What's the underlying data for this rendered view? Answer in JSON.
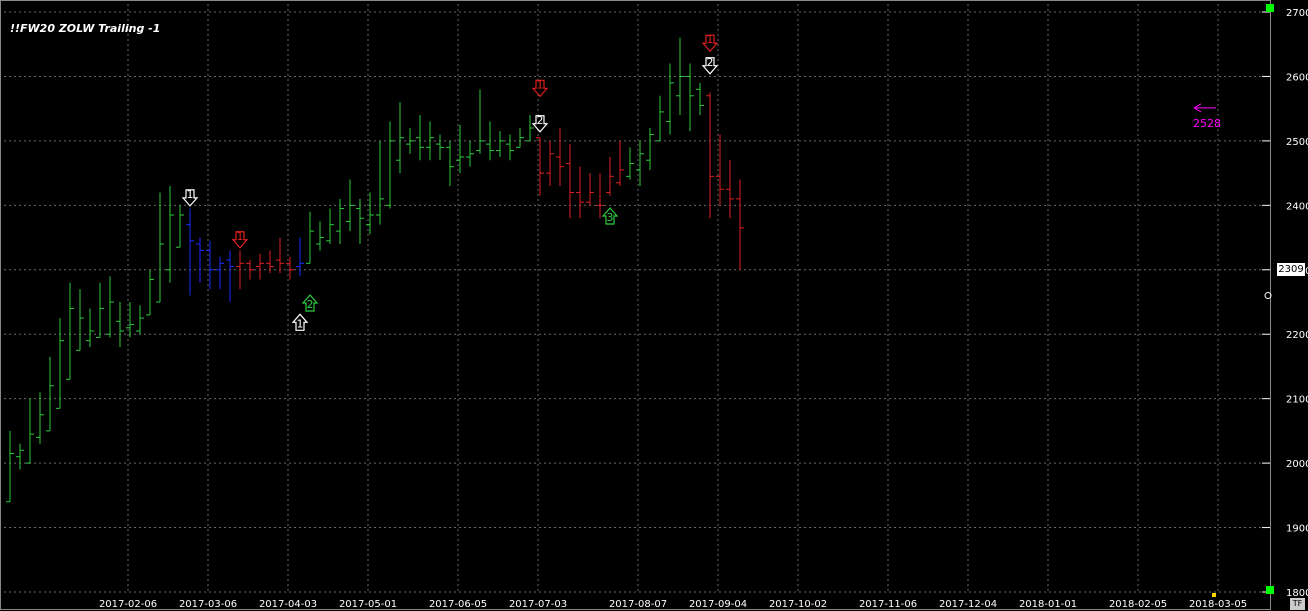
{
  "title": "!!FW20 ZOLW Trailing -1",
  "last_price_label": "2309",
  "stop_label": "2528",
  "corner_label": "TF",
  "colors": {
    "background": "#000000",
    "up": "#2ecc40",
    "down": "#e02020",
    "neutral": "#1a2cff",
    "grid": "#6a6a6a",
    "marker_white": "#ffffff",
    "marker_red": "#e02020",
    "marker_green": "#2ecc40",
    "stop": "#ff00ff"
  },
  "chart_data": {
    "type": "bar",
    "subtype": "ohlc",
    "y_ticks": [
      "1800",
      "1900",
      "2000",
      "2100",
      "2200",
      "2300",
      "2400",
      "2500",
      "2600",
      "2700"
    ],
    "ylim": [
      1800,
      2700
    ],
    "x_ticks": [
      "2017-02-06",
      "2017-03-06",
      "2017-04-03",
      "2017-05-01",
      "2017-06-05",
      "2017-07-03",
      "2017-08-07",
      "2017-09-04",
      "2017-10-02",
      "2017-11-06",
      "2017-12-04",
      "2018-01-01",
      "2018-02-05",
      "2018-03-05"
    ],
    "x_tick_index": [
      12,
      20,
      28,
      36,
      45,
      53,
      63,
      71,
      79,
      88,
      96,
      104,
      113,
      121
    ],
    "bars": [
      {
        "o": 1940,
        "h": 2050,
        "l": 1940,
        "c": 2015,
        "color": "up"
      },
      {
        "o": 2010,
        "h": 2030,
        "l": 1990,
        "c": 2020,
        "color": "up"
      },
      {
        "o": 2000,
        "h": 2100,
        "l": 2000,
        "c": 2045,
        "color": "up"
      },
      {
        "o": 2040,
        "h": 2110,
        "l": 2030,
        "c": 2075,
        "color": "up"
      },
      {
        "o": 2050,
        "h": 2165,
        "l": 2050,
        "c": 2120,
        "color": "up"
      },
      {
        "o": 2085,
        "h": 2225,
        "l": 2085,
        "c": 2190,
        "color": "up"
      },
      {
        "o": 2130,
        "h": 2280,
        "l": 2130,
        "c": 2240,
        "color": "up"
      },
      {
        "o": 2175,
        "h": 2270,
        "l": 2175,
        "c": 2225,
        "color": "up"
      },
      {
        "o": 2190,
        "h": 2240,
        "l": 2180,
        "c": 2205,
        "color": "up"
      },
      {
        "o": 2195,
        "h": 2280,
        "l": 2195,
        "c": 2240,
        "color": "up"
      },
      {
        "o": 2200,
        "h": 2290,
        "l": 2195,
        "c": 2250,
        "color": "up"
      },
      {
        "o": 2220,
        "h": 2250,
        "l": 2180,
        "c": 2205,
        "color": "up"
      },
      {
        "o": 2210,
        "h": 2250,
        "l": 2195,
        "c": 2215,
        "color": "up"
      },
      {
        "o": 2205,
        "h": 2245,
        "l": 2200,
        "c": 2225,
        "color": "up"
      },
      {
        "o": 2230,
        "h": 2300,
        "l": 2230,
        "c": 2285,
        "color": "up"
      },
      {
        "o": 2250,
        "h": 2420,
        "l": 2250,
        "c": 2340,
        "color": "up"
      },
      {
        "o": 2300,
        "h": 2430,
        "l": 2280,
        "c": 2385,
        "color": "up"
      },
      {
        "o": 2335,
        "h": 2400,
        "l": 2335,
        "c": 2385,
        "color": "up"
      },
      {
        "o": 2370,
        "h": 2395,
        "l": 2260,
        "c": 2345,
        "color": "neutral"
      },
      {
        "o": 2340,
        "h": 2350,
        "l": 2280,
        "c": 2330,
        "color": "neutral"
      },
      {
        "o": 2330,
        "h": 2345,
        "l": 2270,
        "c": 2300,
        "color": "neutral"
      },
      {
        "o": 2300,
        "h": 2320,
        "l": 2270,
        "c": 2310,
        "color": "neutral"
      },
      {
        "o": 2315,
        "h": 2330,
        "l": 2250,
        "c": 2305,
        "color": "neutral"
      },
      {
        "o": 2305,
        "h": 2330,
        "l": 2270,
        "c": 2310,
        "color": "down"
      },
      {
        "o": 2310,
        "h": 2315,
        "l": 2285,
        "c": 2300,
        "color": "down"
      },
      {
        "o": 2305,
        "h": 2325,
        "l": 2285,
        "c": 2310,
        "color": "down"
      },
      {
        "o": 2310,
        "h": 2330,
        "l": 2295,
        "c": 2305,
        "color": "down"
      },
      {
        "o": 2315,
        "h": 2350,
        "l": 2295,
        "c": 2310,
        "color": "down"
      },
      {
        "o": 2310,
        "h": 2320,
        "l": 2285,
        "c": 2300,
        "color": "down"
      },
      {
        "o": 2305,
        "h": 2350,
        "l": 2290,
        "c": 2310,
        "color": "neutral"
      },
      {
        "o": 2310,
        "h": 2390,
        "l": 2310,
        "c": 2360,
        "color": "up"
      },
      {
        "o": 2340,
        "h": 2375,
        "l": 2330,
        "c": 2350,
        "color": "up"
      },
      {
        "o": 2345,
        "h": 2395,
        "l": 2340,
        "c": 2370,
        "color": "up"
      },
      {
        "o": 2360,
        "h": 2410,
        "l": 2340,
        "c": 2395,
        "color": "up"
      },
      {
        "o": 2375,
        "h": 2440,
        "l": 2360,
        "c": 2400,
        "color": "up"
      },
      {
        "o": 2395,
        "h": 2410,
        "l": 2340,
        "c": 2380,
        "color": "up"
      },
      {
        "o": 2370,
        "h": 2420,
        "l": 2355,
        "c": 2385,
        "color": "up"
      },
      {
        "o": 2385,
        "h": 2500,
        "l": 2370,
        "c": 2410,
        "color": "up"
      },
      {
        "o": 2400,
        "h": 2530,
        "l": 2395,
        "c": 2500,
        "color": "up"
      },
      {
        "o": 2470,
        "h": 2560,
        "l": 2450,
        "c": 2505,
        "color": "up"
      },
      {
        "o": 2495,
        "h": 2520,
        "l": 2480,
        "c": 2500,
        "color": "up"
      },
      {
        "o": 2505,
        "h": 2540,
        "l": 2470,
        "c": 2490,
        "color": "up"
      },
      {
        "o": 2490,
        "h": 2530,
        "l": 2470,
        "c": 2505,
        "color": "up"
      },
      {
        "o": 2495,
        "h": 2510,
        "l": 2470,
        "c": 2490,
        "color": "up"
      },
      {
        "o": 2490,
        "h": 2500,
        "l": 2430,
        "c": 2460,
        "color": "up"
      },
      {
        "o": 2470,
        "h": 2525,
        "l": 2450,
        "c": 2475,
        "color": "up"
      },
      {
        "o": 2475,
        "h": 2500,
        "l": 2460,
        "c": 2480,
        "color": "up"
      },
      {
        "o": 2485,
        "h": 2580,
        "l": 2480,
        "c": 2500,
        "color": "up"
      },
      {
        "o": 2495,
        "h": 2530,
        "l": 2470,
        "c": 2485,
        "color": "up"
      },
      {
        "o": 2485,
        "h": 2515,
        "l": 2475,
        "c": 2500,
        "color": "up"
      },
      {
        "o": 2495,
        "h": 2510,
        "l": 2470,
        "c": 2485,
        "color": "up"
      },
      {
        "o": 2490,
        "h": 2520,
        "l": 2490,
        "c": 2505,
        "color": "up"
      },
      {
        "o": 2500,
        "h": 2540,
        "l": 2500,
        "c": 2520,
        "color": "up"
      },
      {
        "o": 2505,
        "h": 2505,
        "l": 2415,
        "c": 2450,
        "color": "down"
      },
      {
        "o": 2450,
        "h": 2500,
        "l": 2430,
        "c": 2480,
        "color": "down"
      },
      {
        "o": 2475,
        "h": 2520,
        "l": 2430,
        "c": 2460,
        "color": "down"
      },
      {
        "o": 2465,
        "h": 2495,
        "l": 2380,
        "c": 2420,
        "color": "down"
      },
      {
        "o": 2420,
        "h": 2460,
        "l": 2380,
        "c": 2405,
        "color": "down"
      },
      {
        "o": 2405,
        "h": 2450,
        "l": 2400,
        "c": 2420,
        "color": "down"
      },
      {
        "o": 2400,
        "h": 2450,
        "l": 2380,
        "c": 2400,
        "color": "down"
      },
      {
        "o": 2420,
        "h": 2475,
        "l": 2415,
        "c": 2445,
        "color": "down"
      },
      {
        "o": 2435,
        "h": 2500,
        "l": 2430,
        "c": 2455,
        "color": "down"
      },
      {
        "o": 2445,
        "h": 2490,
        "l": 2440,
        "c": 2465,
        "color": "up"
      },
      {
        "o": 2455,
        "h": 2500,
        "l": 2430,
        "c": 2480,
        "color": "up"
      },
      {
        "o": 2470,
        "h": 2520,
        "l": 2455,
        "c": 2510,
        "color": "up"
      },
      {
        "o": 2500,
        "h": 2570,
        "l": 2500,
        "c": 2545,
        "color": "up"
      },
      {
        "o": 2530,
        "h": 2620,
        "l": 2510,
        "c": 2590,
        "color": "up"
      },
      {
        "o": 2570,
        "h": 2660,
        "l": 2540,
        "c": 2600,
        "color": "up"
      },
      {
        "o": 2600,
        "h": 2620,
        "l": 2515,
        "c": 2570,
        "color": "up"
      },
      {
        "o": 2580,
        "h": 2590,
        "l": 2540,
        "c": 2555,
        "color": "up"
      },
      {
        "o": 2570,
        "h": 2575,
        "l": 2380,
        "c": 2445,
        "color": "down"
      },
      {
        "o": 2445,
        "h": 2510,
        "l": 2400,
        "c": 2425,
        "color": "down"
      },
      {
        "o": 2425,
        "h": 2470,
        "l": 2380,
        "c": 2410,
        "color": "down"
      },
      {
        "o": 2410,
        "h": 2440,
        "l": 2300,
        "c": 2365,
        "color": "down"
      }
    ],
    "markers": [
      {
        "bar": 18,
        "price": 2410,
        "dir": "down",
        "color": "white",
        "label": "1"
      },
      {
        "bar": 23,
        "price": 2345,
        "dir": "down",
        "color": "red",
        "label": "1"
      },
      {
        "bar": 29,
        "price": 2220,
        "dir": "up",
        "color": "white",
        "label": "1"
      },
      {
        "bar": 30,
        "price": 2250,
        "dir": "up",
        "color": "green",
        "label": "2"
      },
      {
        "bar": 53,
        "price": 2580,
        "dir": "down",
        "color": "red",
        "label": "1"
      },
      {
        "bar": 53,
        "price": 2525,
        "dir": "down",
        "color": "white",
        "label": "2"
      },
      {
        "bar": 60,
        "price": 2385,
        "dir": "up",
        "color": "green",
        "label": "3"
      },
      {
        "bar": 70,
        "price": 2650,
        "dir": "down",
        "color": "red",
        "label": "1"
      },
      {
        "bar": 70,
        "price": 2615,
        "dir": "down",
        "color": "white",
        "label": "2"
      }
    ],
    "stop_level": 2528
  }
}
